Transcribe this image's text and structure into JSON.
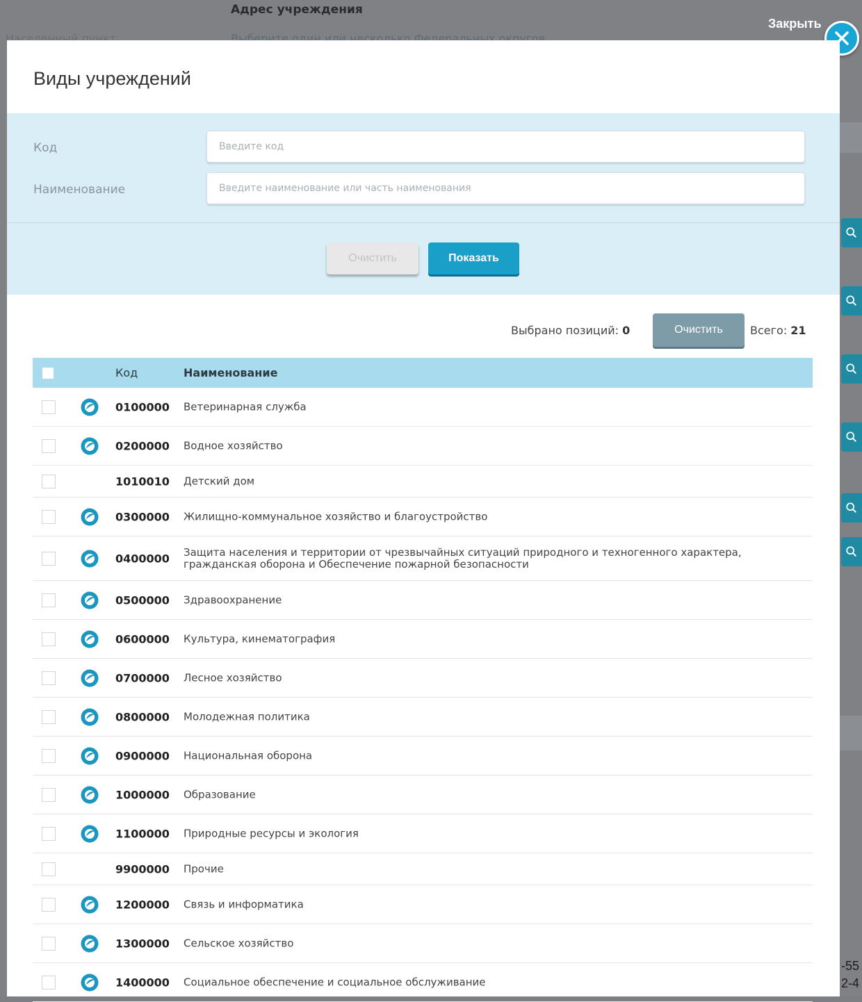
{
  "background": {
    "header_label": "Адрес учреждения",
    "district_select": "Выберите один или несколько Федеральных округов",
    "left_label": "Населенный пункт",
    "right_numbers": [
      "-55",
      "2-4"
    ]
  },
  "close_label": "Закрыть",
  "modal": {
    "title": "Виды учреждений",
    "filters": {
      "code_label": "Код",
      "code_placeholder": "Введите код",
      "name_label": "Наименование",
      "name_placeholder": "Введите наименование или часть наименования"
    },
    "buttons": {
      "clear": "Очистить",
      "show": "Показать"
    },
    "selection": {
      "selected_label": "Выбрано позиций:",
      "selected_count": "0",
      "clear_label": "Очистить",
      "total_label": "Всего:",
      "total_count": "21"
    },
    "table": {
      "columns": [
        "Код",
        "Наименование"
      ],
      "rows": [
        {
          "code": "0100000",
          "name": "Ветеринарная служба",
          "expandable": true
        },
        {
          "code": "0200000",
          "name": "Водное хозяйство",
          "expandable": true
        },
        {
          "code": "1010010",
          "name": "Детский дом",
          "expandable": false
        },
        {
          "code": "0300000",
          "name": "Жилищно-коммунальное хозяйство и благоустройство",
          "expandable": true
        },
        {
          "code": "0400000",
          "name": "Защита населения и территории от чрезвычайных ситуаций природного и техногенного характера, гражданская оборона и Обеспечение пожарной безопасности",
          "expandable": true
        },
        {
          "code": "0500000",
          "name": "Здравоохранение",
          "expandable": true
        },
        {
          "code": "0600000",
          "name": "Культура, кинематография",
          "expandable": true
        },
        {
          "code": "0700000",
          "name": "Лесное хозяйство",
          "expandable": true
        },
        {
          "code": "0800000",
          "name": "Молодежная политика",
          "expandable": true
        },
        {
          "code": "0900000",
          "name": "Национальная оборона",
          "expandable": true
        },
        {
          "code": "1000000",
          "name": "Образование",
          "expandable": true
        },
        {
          "code": "1100000",
          "name": "Природные ресурсы и экология",
          "expandable": true
        },
        {
          "code": "9900000",
          "name": "Прочие",
          "expandable": false
        },
        {
          "code": "1200000",
          "name": "Связь и информатика",
          "expandable": true
        },
        {
          "code": "1300000",
          "name": "Сельское хозяйство",
          "expandable": true
        },
        {
          "code": "1400000",
          "name": "Социальное обеспечение и социальное обслуживание",
          "expandable": true
        }
      ]
    }
  },
  "colors": {
    "accent": "#1aa0c8",
    "filter_panel": "#daeef7",
    "table_header": "#a9dbef",
    "side_buttons": "#1f8aa1"
  }
}
